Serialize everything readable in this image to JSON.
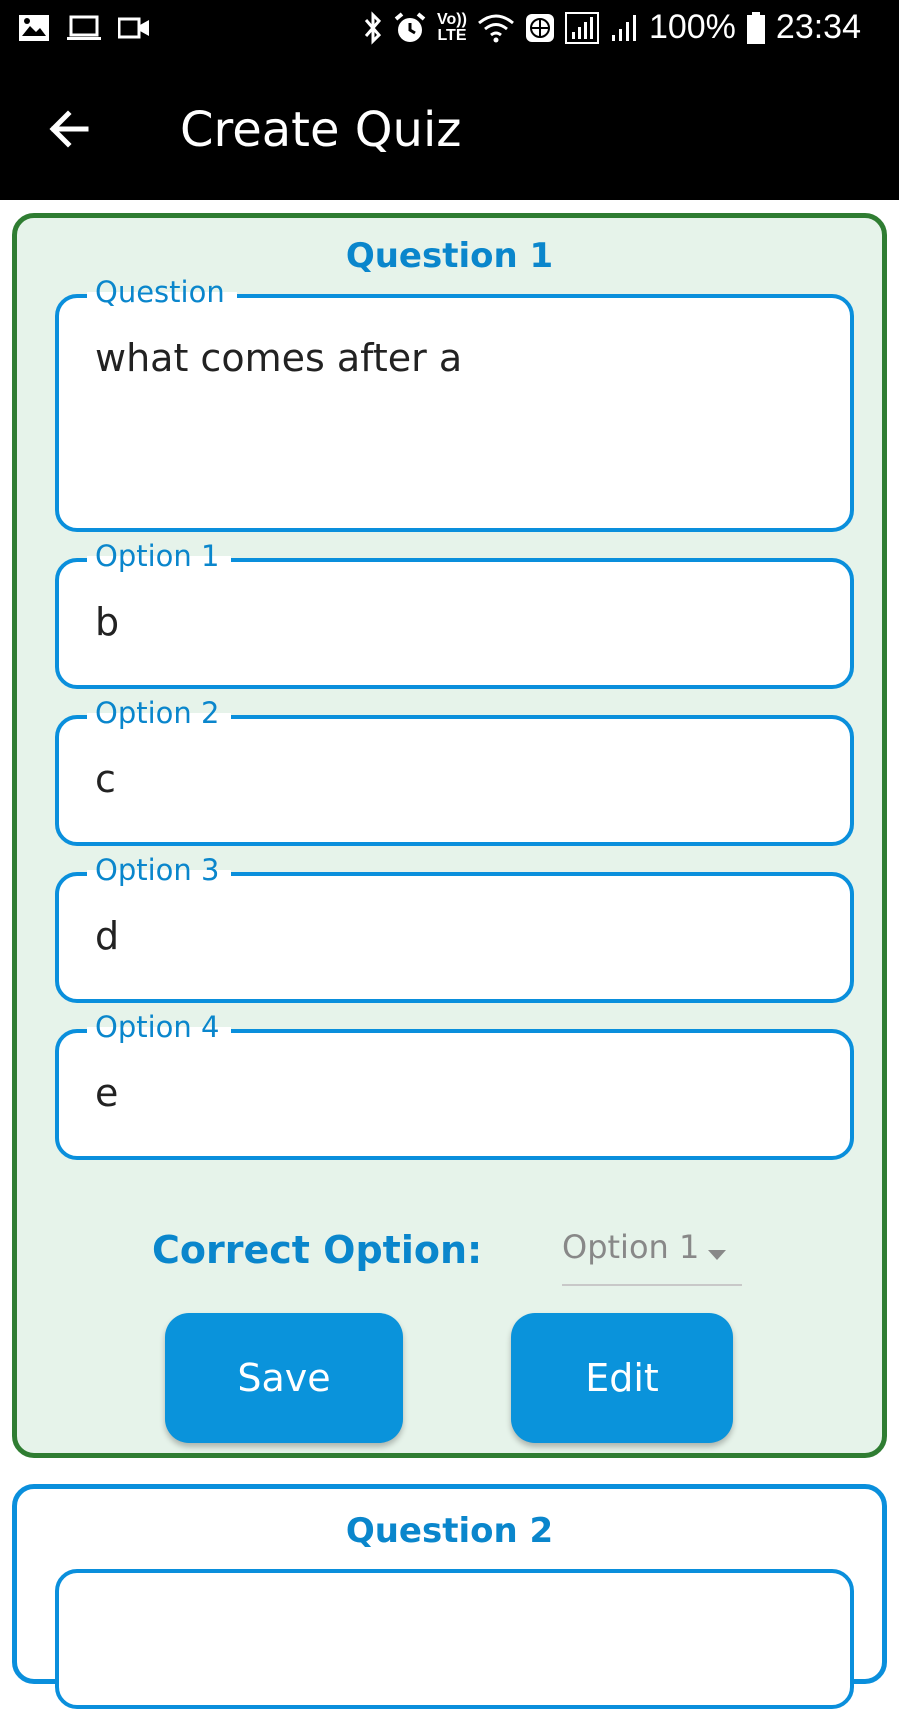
{
  "status_bar": {
    "volte": "Vo))",
    "lte": "LTE",
    "battery": "100%",
    "time": "23:34"
  },
  "app_bar": {
    "title": "Create Quiz"
  },
  "questions": [
    {
      "heading": "Question 1",
      "question_label": "Question",
      "question_value": "what comes after a",
      "options": [
        {
          "label": "Option 1",
          "value": "b"
        },
        {
          "label": "Option 2",
          "value": "c"
        },
        {
          "label": "Option 3",
          "value": "d"
        },
        {
          "label": "Option 4",
          "value": "e"
        }
      ],
      "correct_option_label": "Correct Option:",
      "correct_option_selected": "Option 1",
      "save_label": "Save",
      "edit_label": "Edit"
    },
    {
      "heading": "Question 2"
    }
  ],
  "colors": {
    "accent": "#0a8fdc",
    "card_border_active": "#2f7d32",
    "card_bg_active": "#e6f3ea"
  }
}
